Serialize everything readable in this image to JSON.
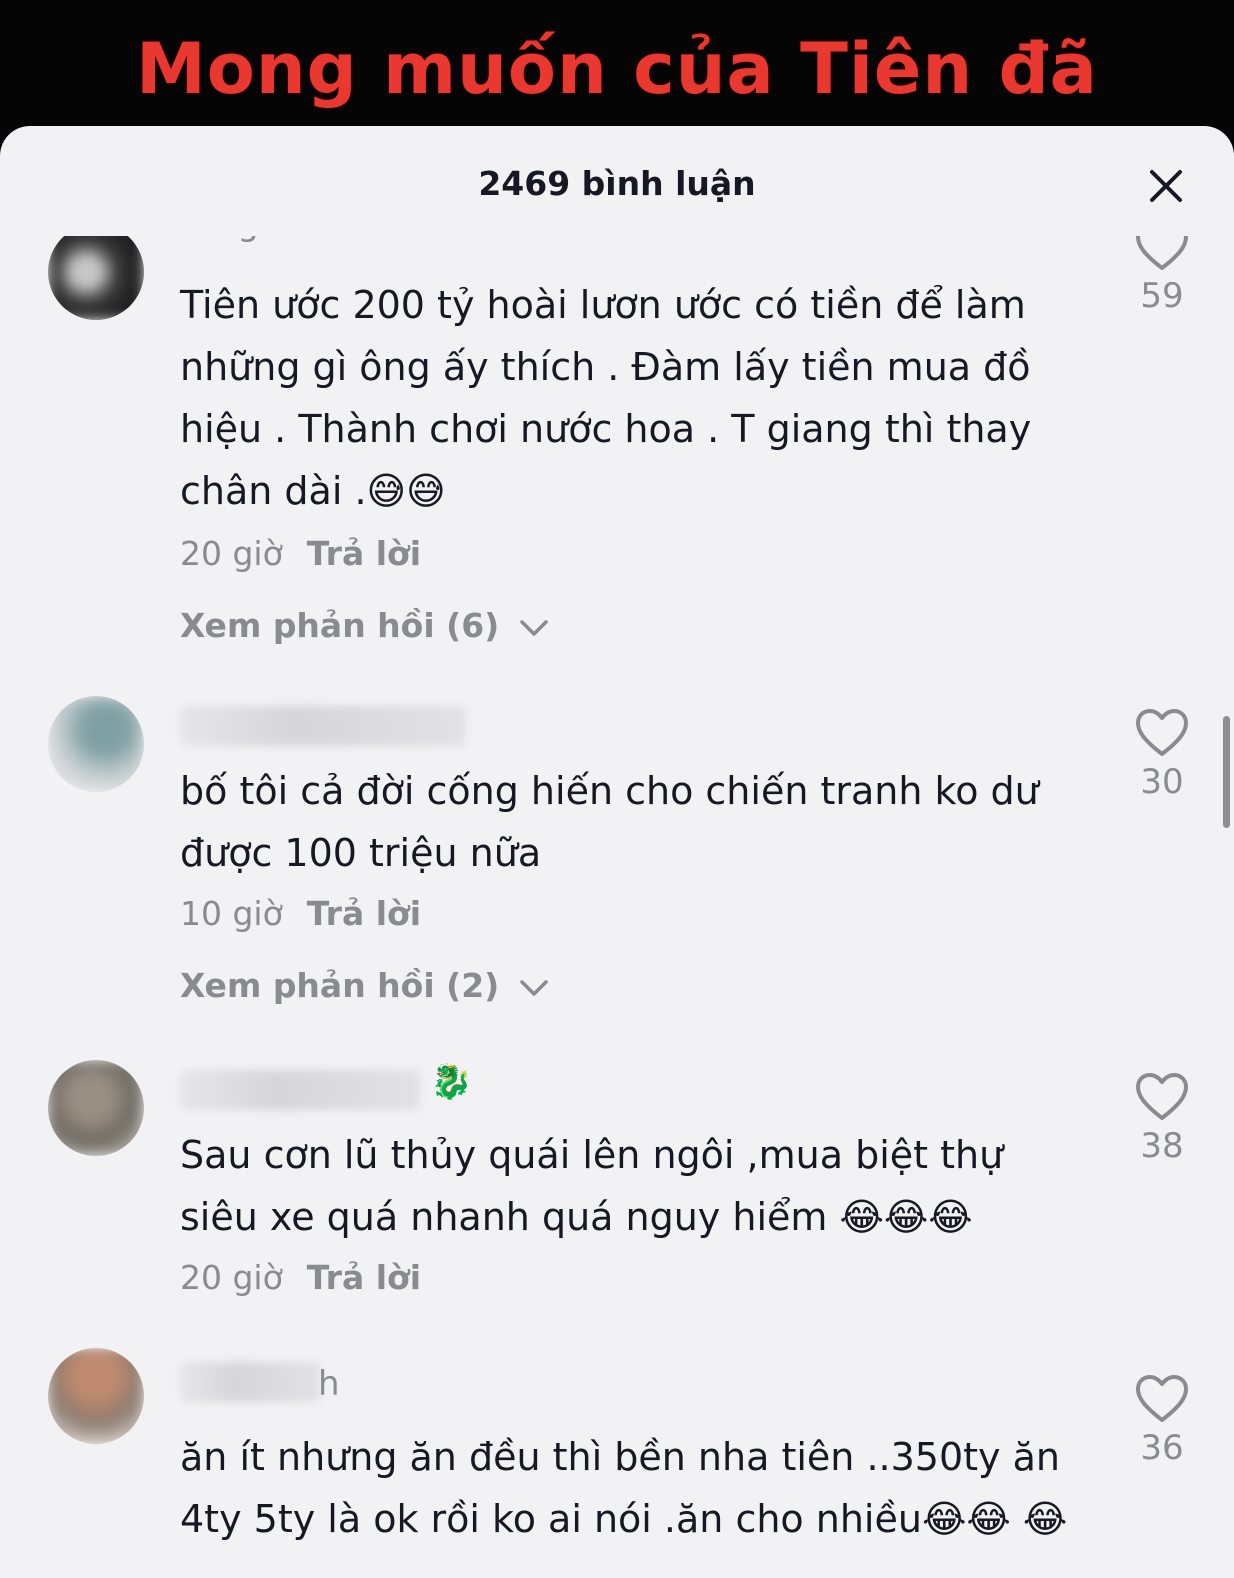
{
  "video": {
    "caption": "Mong muốn của Tiên đã"
  },
  "sheet": {
    "title": "2469 bình luận"
  },
  "comments": [
    {
      "username": "AB gold",
      "text": "Tiên ước 200 tỷ hoài lươn ước có tiền để làm những gì ông ấy thích . Đàm lấy tiền mua đồ hiệu . Thành chơi nước hoa . T giang thì thay chân dài .😅😅",
      "time": "20 giờ",
      "reply_label": "Trả lời",
      "view_replies": "Xem phản hồi (6)",
      "likes": "59"
    },
    {
      "username": "",
      "text": "bố tôi cả đời cống hiến cho chiến tranh ko dư được 100 triệu nữa",
      "time": "10 giờ",
      "reply_label": "Trả lời",
      "view_replies": "Xem phản hồi (2)",
      "likes": "30"
    },
    {
      "username_suffix": "🐉",
      "text": "Sau cơn lũ thủy quái lên ngôi ,mua biệt thự siêu xe quá nhanh quá nguy hiểm 😂😂😂",
      "time": "20 giờ",
      "reply_label": "Trả lời",
      "likes": "38"
    },
    {
      "username_suffix": "h",
      "text": "ăn ít nhưng ăn đều thì bền nha tiên ..350ty ăn 4ty 5ty là ok rồi ko ai nói .ăn cho nhiều😂😂 😂",
      "likes": "36"
    }
  ],
  "icons": {
    "close": "close-icon",
    "like": "heart-outline-icon",
    "expand": "chevron-down-icon"
  },
  "colors": {
    "caption": "#e8382f",
    "sheet_bg": "#f2f2f4",
    "text": "#161823",
    "muted": "#8a8b91"
  }
}
